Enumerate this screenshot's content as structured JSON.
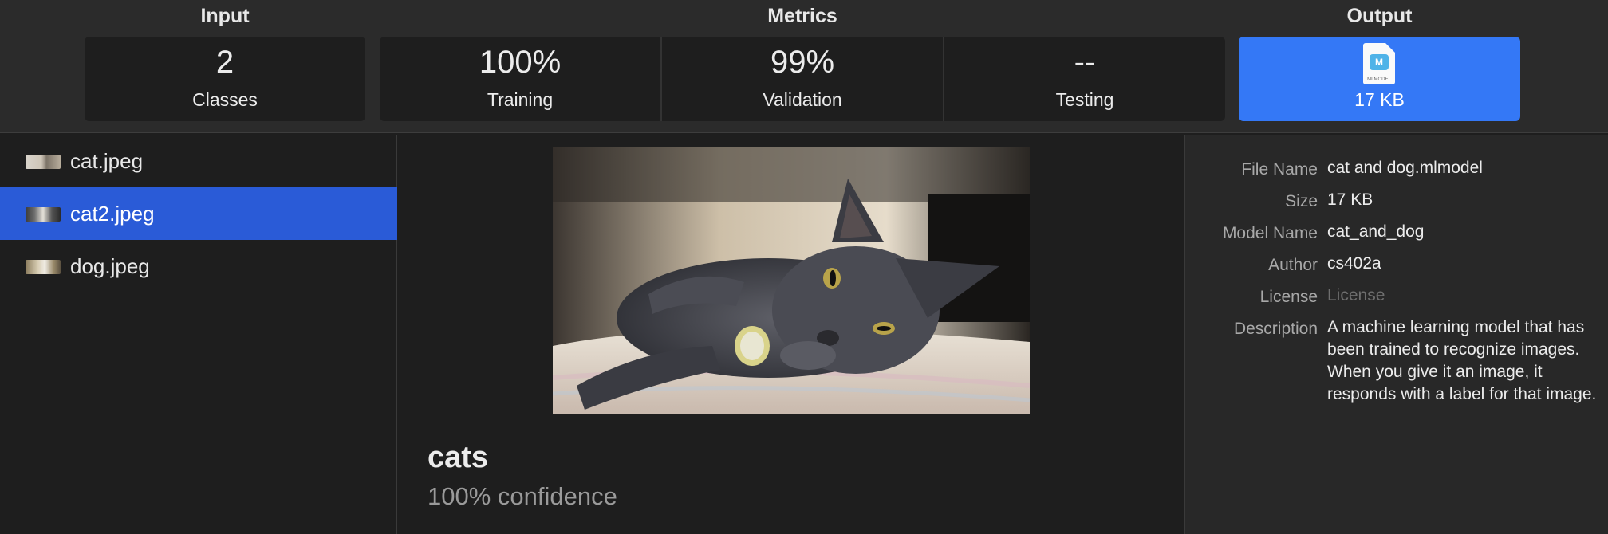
{
  "header": {
    "input_title": "Input",
    "metrics_title": "Metrics",
    "output_title": "Output",
    "input": {
      "value": "2",
      "label": "Classes"
    },
    "metrics": [
      {
        "value": "100%",
        "label": "Training"
      },
      {
        "value": "99%",
        "label": "Validation"
      },
      {
        "value": "--",
        "label": "Testing"
      }
    ],
    "output": {
      "icon": "mlmodel-file-icon",
      "icon_badge": "M",
      "icon_caption": "MLMODEL",
      "size": "17 KB"
    }
  },
  "files": [
    {
      "name": "cat.jpeg",
      "selected": false
    },
    {
      "name": "cat2.jpeg",
      "selected": true
    },
    {
      "name": "dog.jpeg",
      "selected": false
    }
  ],
  "preview": {
    "label": "cats",
    "confidence": "100% confidence"
  },
  "details": [
    {
      "key": "File Name",
      "value": "cat and dog.mlmodel"
    },
    {
      "key": "Size",
      "value": "17 KB"
    },
    {
      "key": "Model Name",
      "value": "cat_and_dog"
    },
    {
      "key": "Author",
      "value": "cs402a"
    },
    {
      "key": "License",
      "value": "License"
    },
    {
      "key": "Description",
      "value": "A machine learning model that has been trained to recognize images. When you give it an image, it responds with a label for that image."
    }
  ],
  "colors": {
    "accent": "#3478f6",
    "selection": "#2a5bd7",
    "background": "#1e1e1e",
    "header_background": "#2b2b2b"
  }
}
